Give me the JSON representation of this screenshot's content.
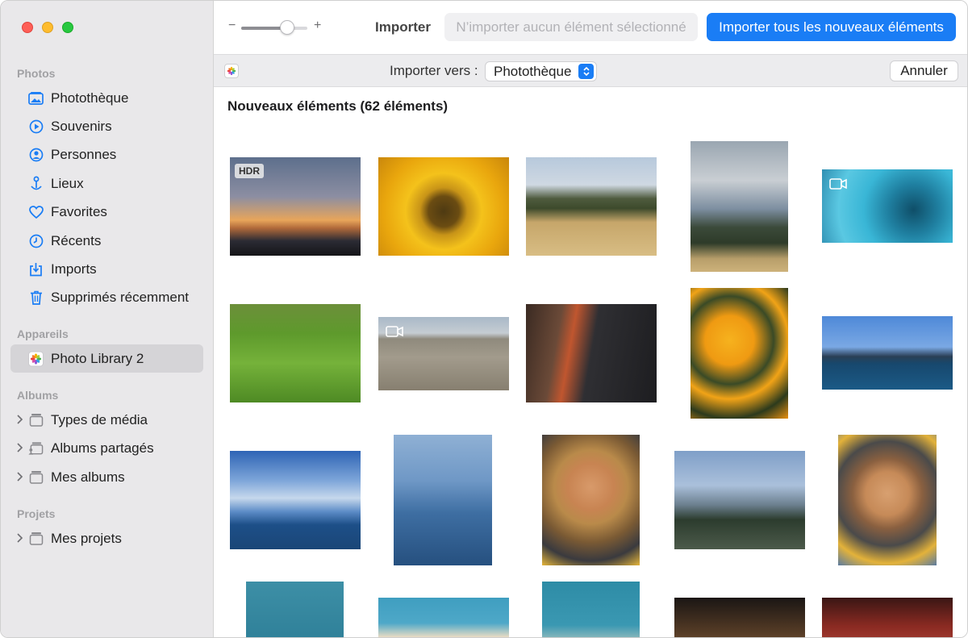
{
  "sidebar": {
    "sections": {
      "photos": "Photos",
      "devices": "Appareils",
      "albums": "Albums",
      "projects": "Projets"
    },
    "photos_items": [
      {
        "label": "Photothèque",
        "icon": "library-icon"
      },
      {
        "label": "Souvenirs",
        "icon": "memories-icon"
      },
      {
        "label": "Personnes",
        "icon": "people-icon"
      },
      {
        "label": "Lieux",
        "icon": "places-icon"
      },
      {
        "label": "Favorites",
        "icon": "heart-icon"
      },
      {
        "label": "Récents",
        "icon": "clock-icon"
      },
      {
        "label": "Imports",
        "icon": "import-icon"
      },
      {
        "label": "Supprimés récemment",
        "icon": "trash-icon"
      }
    ],
    "device_items": [
      {
        "label": "Photo Library 2",
        "icon": "photos-app-icon",
        "selected": true
      }
    ],
    "album_items": [
      {
        "label": "Types de média",
        "icon": "folder-icon"
      },
      {
        "label": "Albums partagés",
        "icon": "shared-folder-icon"
      },
      {
        "label": "Mes albums",
        "icon": "folder-icon"
      }
    ],
    "project_items": [
      {
        "label": "Mes projets",
        "icon": "folder-icon"
      }
    ]
  },
  "toolbar": {
    "zoom_minus": "−",
    "zoom_plus": "+",
    "zoom_level": 0.7,
    "import_label": "Importer",
    "import_none_label": "N’importer aucun élément sélectionné",
    "import_all_label": "Importer tous les nouveaux éléments"
  },
  "subbar": {
    "destination_label": "Importer vers :",
    "destination_value": "Photothèque",
    "cancel_label": "Annuler"
  },
  "grid": {
    "title": "Nouveaux éléments (62 éléments)",
    "hdr_badge": "HDR",
    "items": [
      {
        "subject": "sunset-beach",
        "badge": "HDR"
      },
      {
        "subject": "sunflower",
        "badge": ""
      },
      {
        "subject": "hill-field",
        "badge": ""
      },
      {
        "subject": "hill-landscape",
        "badge": ""
      },
      {
        "subject": "blue-smoke",
        "badge": "video"
      },
      {
        "subject": "rice-field",
        "badge": ""
      },
      {
        "subject": "concrete-wall",
        "badge": "video"
      },
      {
        "subject": "street-cyclist",
        "badge": ""
      },
      {
        "subject": "orange-flowers",
        "badge": ""
      },
      {
        "subject": "lake-shore",
        "badge": ""
      },
      {
        "subject": "sky-sea",
        "badge": ""
      },
      {
        "subject": "child-in-water",
        "badge": ""
      },
      {
        "subject": "curly-child",
        "badge": ""
      },
      {
        "subject": "tree-hikers",
        "badge": ""
      },
      {
        "subject": "curly-child-side",
        "badge": ""
      },
      {
        "subject": "pool-dog",
        "badge": ""
      },
      {
        "subject": "dog-head",
        "badge": ""
      },
      {
        "subject": "dog-head-2",
        "badge": ""
      },
      {
        "subject": "dog-interior",
        "badge": ""
      },
      {
        "subject": "red-room",
        "badge": ""
      }
    ]
  },
  "colors": {
    "accent": "#1a7df5",
    "sidebar_bg": "#e9e8ea",
    "selected_bg": "#d5d4d7"
  }
}
